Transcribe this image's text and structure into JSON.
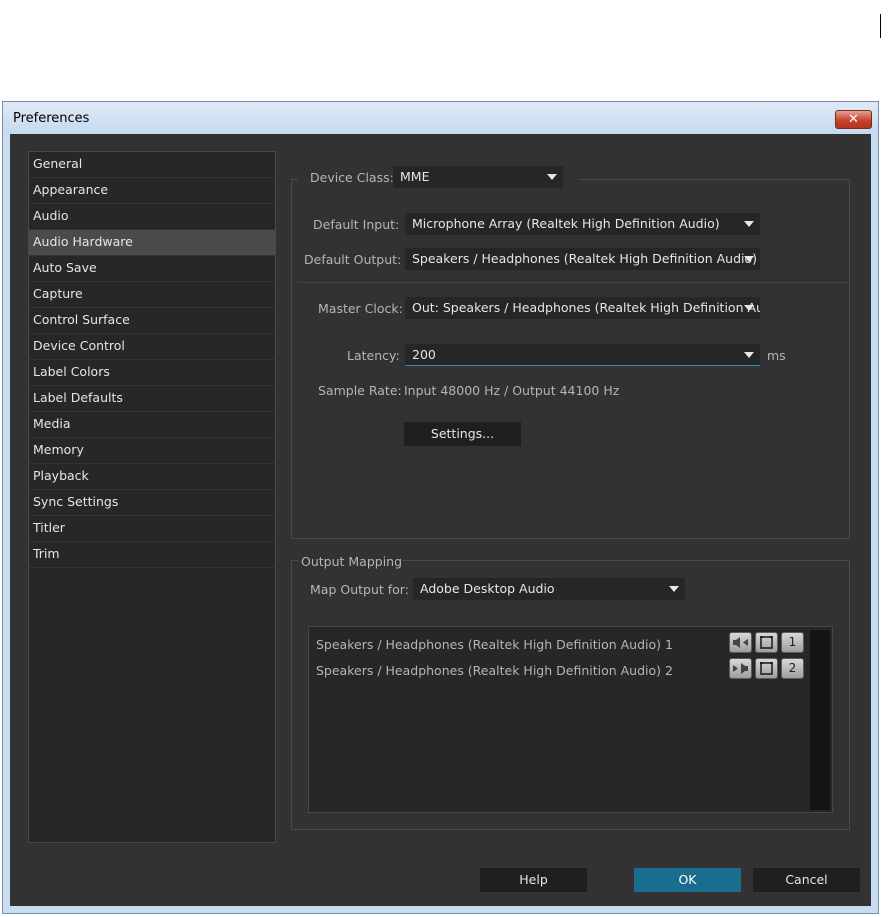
{
  "window": {
    "title": "Preferences",
    "close_glyph": "✕"
  },
  "sidebar": {
    "selected_index": 3,
    "items": [
      {
        "label": "General"
      },
      {
        "label": "Appearance"
      },
      {
        "label": "Audio"
      },
      {
        "label": "Audio Hardware"
      },
      {
        "label": "Auto Save"
      },
      {
        "label": "Capture"
      },
      {
        "label": "Control Surface"
      },
      {
        "label": "Device Control"
      },
      {
        "label": "Label Colors"
      },
      {
        "label": "Label Defaults"
      },
      {
        "label": "Media"
      },
      {
        "label": "Memory"
      },
      {
        "label": "Playback"
      },
      {
        "label": "Sync Settings"
      },
      {
        "label": "Titler"
      },
      {
        "label": "Trim"
      }
    ]
  },
  "device": {
    "class_label": "Device Class:",
    "class_value": "MME",
    "default_input_label": "Default Input:",
    "default_input_value": "Microphone Array (Realtek High Definition Audio)",
    "default_output_label": "Default Output:",
    "default_output_value": "Speakers / Headphones (Realtek High Definition Audio)",
    "master_clock_label": "Master Clock:",
    "master_clock_value": "Out: Speakers / Headphones (Realtek High Definition Au",
    "latency_label": "Latency:",
    "latency_value": "200",
    "latency_unit": "ms",
    "sample_rate_label": "Sample Rate:",
    "sample_rate_value": "Input 48000 Hz / Output 44100 Hz",
    "settings_button": "Settings..."
  },
  "output_mapping": {
    "title": "Output Mapping",
    "map_for_label": "Map Output for:",
    "map_for_value": "Adobe Desktop Audio",
    "rows": [
      {
        "label": "Speakers / Headphones (Realtek High Definition Audio) 1",
        "channel": "1"
      },
      {
        "label": "Speakers / Headphones (Realtek High Definition Audio) 2",
        "channel": "2"
      }
    ]
  },
  "footer": {
    "help": "Help",
    "ok": "OK",
    "cancel": "Cancel"
  },
  "colors": {
    "accent": "#1b6d8f",
    "panel": "#323232",
    "focus_underline": "#2f8ab8"
  }
}
